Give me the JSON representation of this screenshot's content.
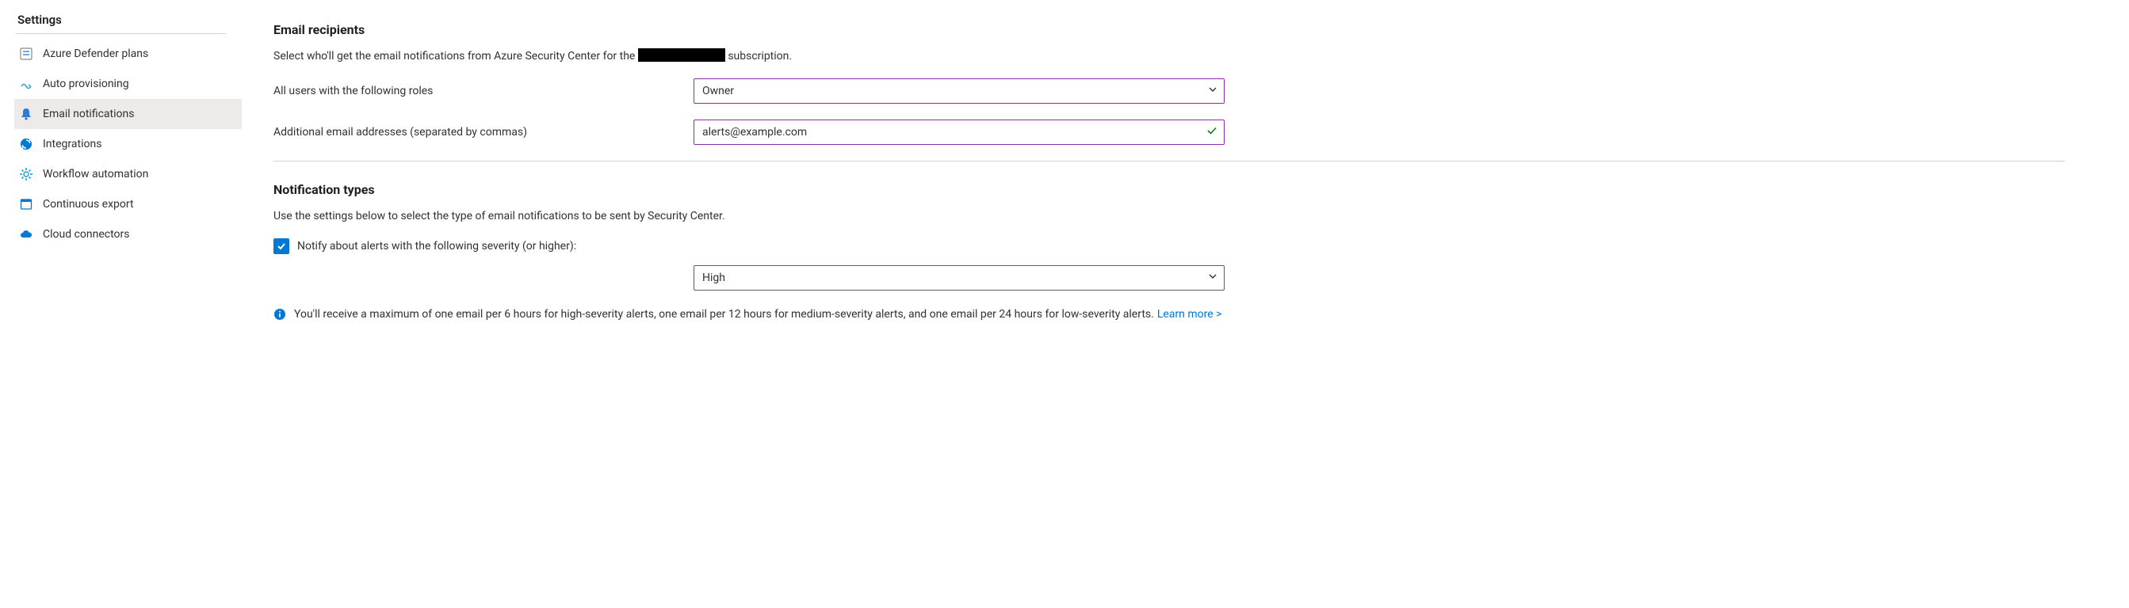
{
  "sidebar": {
    "title": "Settings",
    "items": [
      {
        "label": "Azure Defender plans"
      },
      {
        "label": "Auto provisioning"
      },
      {
        "label": "Email notifications"
      },
      {
        "label": "Integrations"
      },
      {
        "label": "Workflow automation"
      },
      {
        "label": "Continuous export"
      },
      {
        "label": "Cloud connectors"
      }
    ],
    "activeIndex": 2
  },
  "emailRecipients": {
    "heading": "Email recipients",
    "desc_pre": "Select who'll get the email notifications from Azure Security Center for the ",
    "desc_post": " subscription.",
    "roles_label": "All users with the following roles",
    "roles_value": "Owner",
    "emails_label": "Additional email addresses (separated by commas)",
    "emails_value": "alerts@example.com"
  },
  "notificationTypes": {
    "heading": "Notification types",
    "desc": "Use the settings below to select the type of email notifications to be sent by Security Center.",
    "notify_label": "Notify about alerts with the following severity (or higher):",
    "notify_checked": true,
    "severity_value": "High",
    "info_text": "You'll receive a maximum of one email per 6 hours for high-severity alerts, one email per 12 hours for medium-severity alerts, and one email per 24 hours for low-severity alerts.",
    "learn_more": "Learn more >"
  }
}
